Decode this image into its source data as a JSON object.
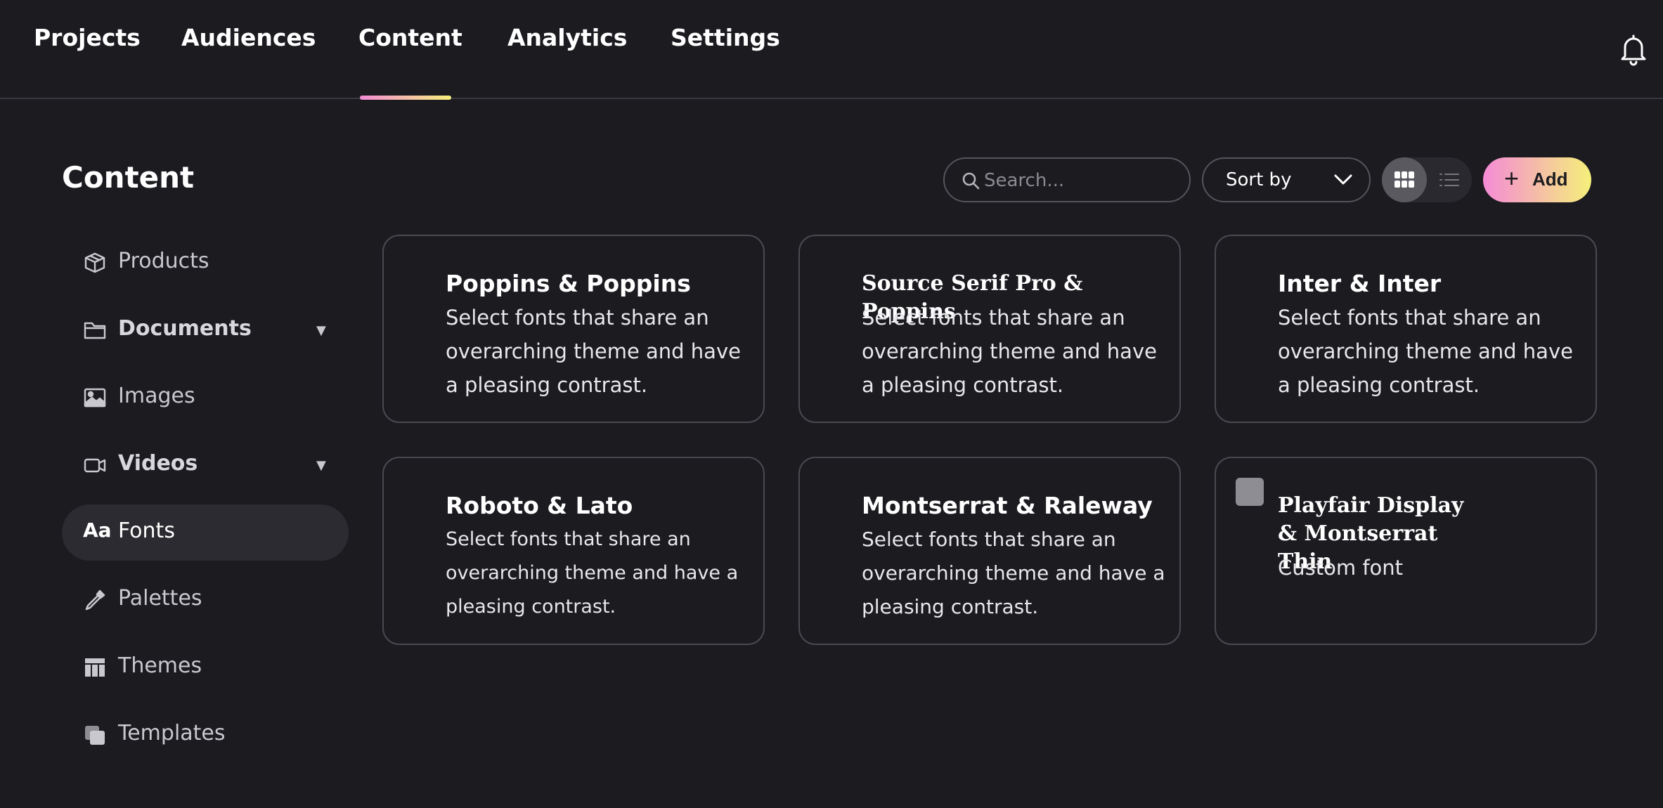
{
  "nav": {
    "tabs": [
      {
        "label": "Projects"
      },
      {
        "label": "Audiences"
      },
      {
        "label": "Content"
      },
      {
        "label": "Analytics"
      },
      {
        "label": "Settings"
      }
    ],
    "active_tab": "Content",
    "notification_icon": "bell-icon"
  },
  "sidebar": {
    "title": "Content",
    "items": [
      {
        "label": "Products",
        "icon": "box-icon"
      },
      {
        "label": "Documents",
        "icon": "folder-icon",
        "expandable": true
      },
      {
        "label": "Images",
        "icon": "image-icon"
      },
      {
        "label": "Videos",
        "icon": "video-icon",
        "expandable": true
      },
      {
        "label": "Fonts",
        "icon": "font-icon",
        "icon_text": "Aa",
        "active": true
      },
      {
        "label": "Palettes",
        "icon": "eyedropper-icon"
      },
      {
        "label": "Themes",
        "icon": "layout-icon"
      },
      {
        "label": "Templates",
        "icon": "copy-icon"
      }
    ]
  },
  "toolbar": {
    "search_placeholder": "Search...",
    "sort_label": "Sort by",
    "add_label": "Add",
    "view_mode": "grid"
  },
  "cards": [
    {
      "title": "Poppins & Poppins",
      "description": "Select fonts that share an overarching theme and have a pleasing contrast."
    },
    {
      "title": "Source Serif Pro & Poppins",
      "description": "Select fonts that share an overarching theme and have a pleasing contrast."
    },
    {
      "title": "Inter & Inter",
      "description": "Select fonts that share an overarching theme and have a pleasing contrast."
    },
    {
      "title": "Roboto & Lato",
      "description": "Select fonts that share an overarching theme and have a pleasing contrast."
    },
    {
      "title": "Montserrat & Raleway",
      "description": "Select fonts that share an overarching theme and have a pleasing contrast."
    },
    {
      "title": "Playfair Display & Montserrat Thin",
      "description": "Custom font"
    }
  ],
  "colors": {
    "background": "#1c1b20",
    "accent_gradient_start": "#f58bd6",
    "accent_gradient_end": "#f5ef7a",
    "border": "#4a4950"
  }
}
